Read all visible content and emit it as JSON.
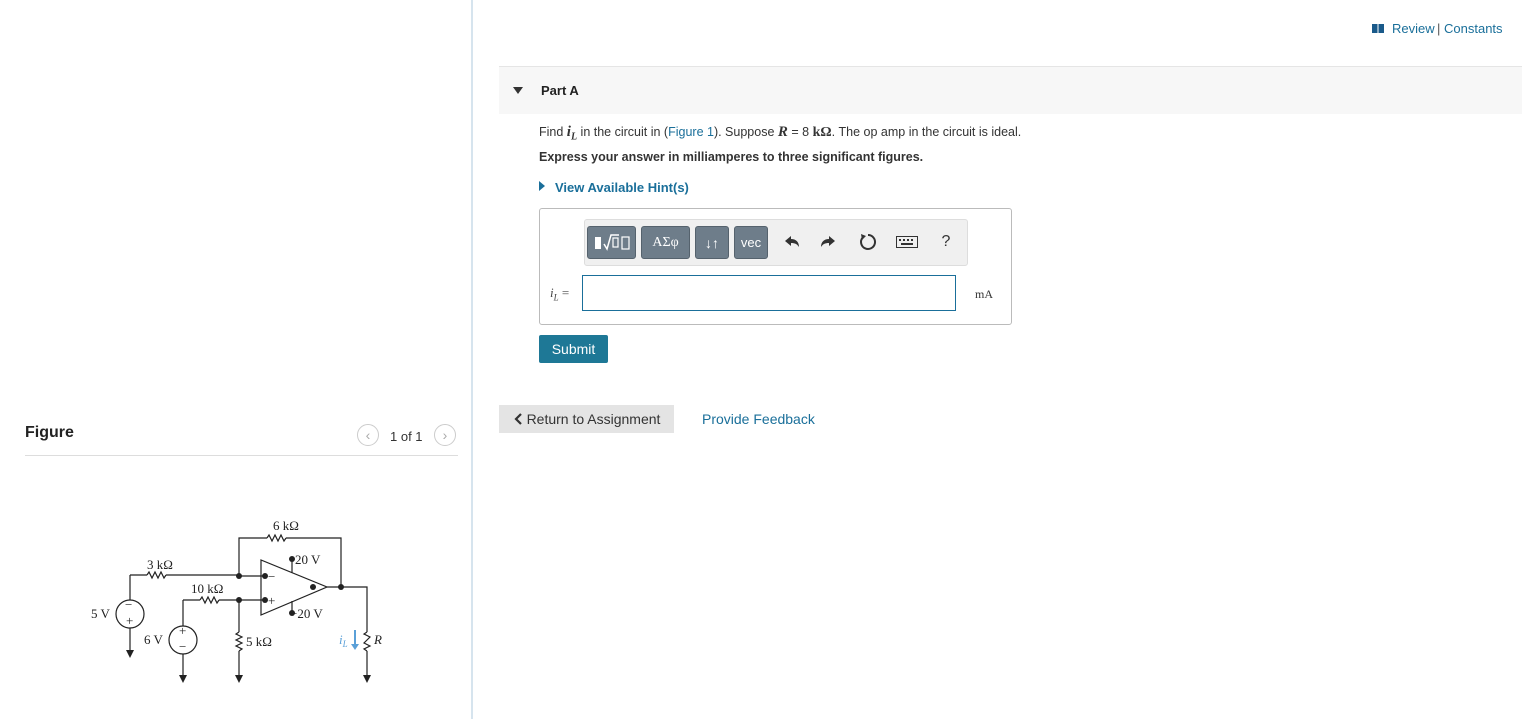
{
  "header": {
    "review_label": "Review",
    "separator": "|",
    "constants_label": "Constants"
  },
  "part": {
    "title": "Part A"
  },
  "question": {
    "p1": "Find ",
    "var": "i",
    "var_sub": "L",
    "p2": " in the circuit in (",
    "fig_link": "Figure 1",
    "p3": "). Suppose ",
    "r_sym": "R",
    "r_val": " = 8 ",
    "r_unit": "kΩ",
    "p4": ". The op amp in the circuit is ideal.",
    "instruction": "Express your answer in milliamperes to three significant figures."
  },
  "hints": {
    "label": "View Available Hint(s)"
  },
  "toolbar": {
    "templates_label": "√",
    "greek_label": "ΑΣφ",
    "arrows_label": "↓↑",
    "vec_label": "vec",
    "help_label": "?"
  },
  "answer": {
    "label": "i",
    "label_sub": "L",
    "eq": "=",
    "value": "",
    "unit": "mA"
  },
  "actions": {
    "submit_label": "Submit",
    "return_label": "Return to Assignment",
    "feedback_label": "Provide Feedback"
  },
  "figure": {
    "title": "Figure",
    "pager": "1 of 1",
    "labels": {
      "r6k": "6 kΩ",
      "r3k": "3 kΩ",
      "r10k": "10 kΩ",
      "r5k": "5 kΩ",
      "vpos": "20 V",
      "vneg": "−20 V",
      "v5": "5 V",
      "v6": "6 V",
      "il": "i",
      "il_sub": "L",
      "r": "R",
      "plus": "+",
      "minus": "−"
    }
  }
}
